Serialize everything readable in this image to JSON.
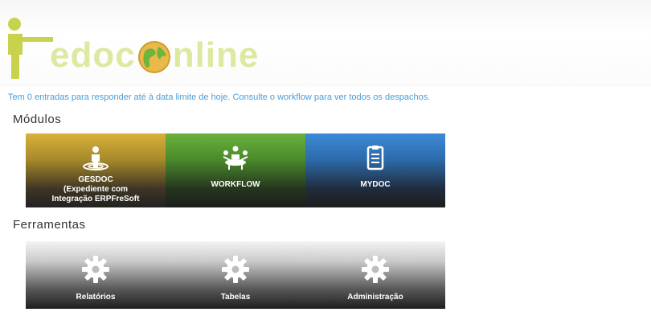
{
  "header": {
    "logo_alt": "edoc globe logo"
  },
  "notice": "Tem 0 entradas para responder até à data limite de hoje. Consulte o workflow para ver todos os despachos.",
  "modules": {
    "title": "Módulos",
    "tiles": [
      {
        "label_line1": "GESDOC",
        "label_line2": "(Expediente com",
        "label_line3": "Integração ERPFreSoft",
        "icon": "person-with-target-icon",
        "color": "#c9a233"
      },
      {
        "label_line1": "WORKFLOW",
        "icon": "meeting-table-icon",
        "color": "#5ea235"
      },
      {
        "label_line1": "MYDOC",
        "icon": "clipboard-icon",
        "color": "#3a82cf"
      }
    ]
  },
  "tools": {
    "title": "Ferramentas",
    "tiles": [
      {
        "label": "Relatórios",
        "icon": "gear-icon"
      },
      {
        "label": "Tabelas",
        "icon": "gear-icon"
      },
      {
        "label": "Administração",
        "icon": "gear-icon"
      }
    ]
  }
}
